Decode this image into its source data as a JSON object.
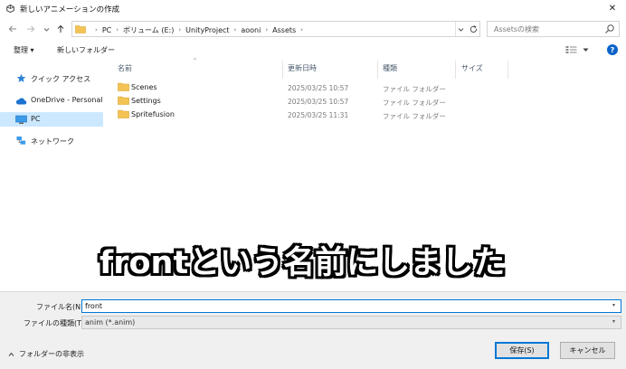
{
  "window": {
    "title": "新しいアニメーションの作成",
    "close_glyph": "✕"
  },
  "address": {
    "crumbs": [
      "PC",
      "ボリューム (E:)",
      "UnityProject",
      "aooni",
      "Assets"
    ],
    "search_placeholder": "Assetsの検索"
  },
  "toolbar": {
    "organize_label": "整理 ▾",
    "new_folder_label": "新しいフォルダー",
    "help_glyph": "?"
  },
  "sidebar": {
    "items": [
      {
        "label": "クイック アクセス",
        "icon": "star-icon"
      },
      {
        "label": "OneDrive - Personal",
        "icon": "cloud-icon"
      },
      {
        "label": "PC",
        "icon": "monitor-icon"
      },
      {
        "label": "ネットワーク",
        "icon": "network-icon"
      }
    ]
  },
  "columns": {
    "name": "名前",
    "date": "更新日時",
    "type": "種類",
    "size": "サイズ"
  },
  "files": [
    {
      "name": "Scenes",
      "date": "2025/03/25 10:57",
      "type": "ファイル フォルダー"
    },
    {
      "name": "Settings",
      "date": "2025/03/25 10:57",
      "type": "ファイル フォルダー"
    },
    {
      "name": "Spritefusion",
      "date": "2025/03/25 11:31",
      "type": "ファイル フォルダー"
    }
  ],
  "caption": "frontという名前にしました",
  "form": {
    "filename_label": "ファイル名(N):",
    "filename_value": "front",
    "filetype_label": "ファイルの種類(T):",
    "filetype_value": "anim (*.anim)",
    "hide_folders_label": "フォルダーの非表示",
    "save_label": "保存(S)",
    "cancel_label": "キャンセル"
  },
  "colors": {
    "folder": "#f3c355",
    "selection": "#cce8ff",
    "accent": "#0078d7"
  }
}
